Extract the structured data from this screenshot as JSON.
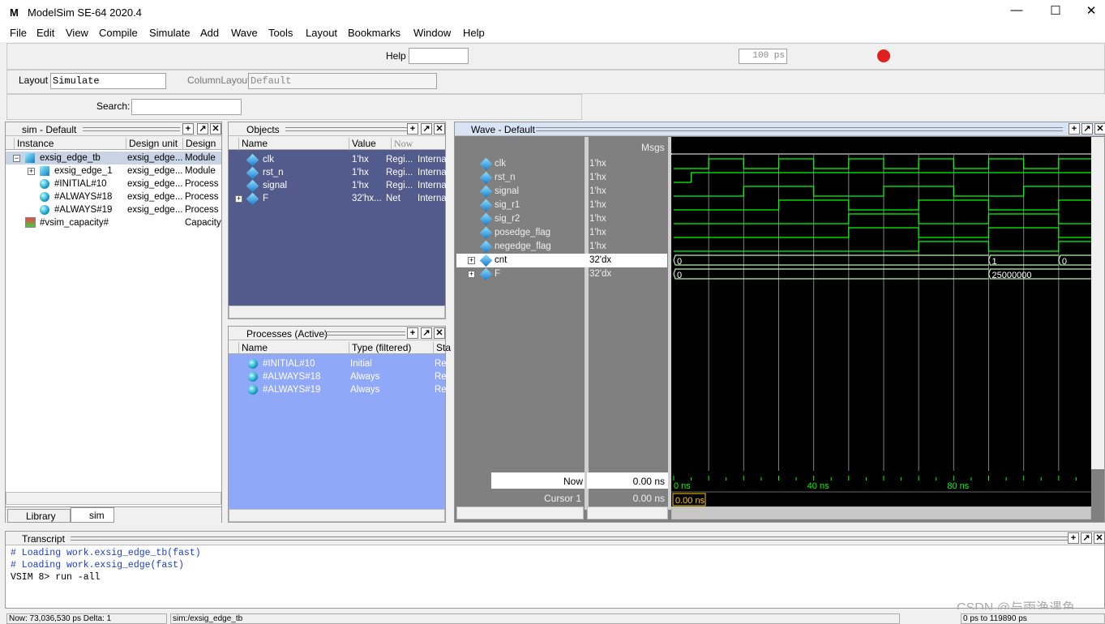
{
  "app": {
    "title": "ModelSim SE-64 2020.4",
    "logo": "M"
  },
  "menu": [
    "File",
    "Edit",
    "View",
    "Compile",
    "Simulate",
    "Add",
    "Wave",
    "Tools",
    "Layout",
    "Bookmarks",
    "Window",
    "Help"
  ],
  "toolbar": {
    "help_label": "Help",
    "help_value": "",
    "run_length": "100 ps",
    "layout_label": "Layout",
    "layout_value": "Simulate",
    "column_layout_label": "ColumnLayout",
    "column_layout_value": "Default",
    "search_label": "Search:",
    "search_value": ""
  },
  "sim_panel": {
    "title": "sim - Default",
    "columns": [
      "Instance",
      "Design unit",
      "Design ur"
    ],
    "rows": [
      {
        "name": "exsig_edge_tb",
        "unit": "exsig_edge...",
        "type": "Module"
      },
      {
        "name": "exsig_edge_1",
        "unit": "exsig_edge...",
        "type": "Module"
      },
      {
        "name": "#INITIAL#10",
        "unit": "exsig_edge...",
        "type": "Process"
      },
      {
        "name": "#ALWAYS#18",
        "unit": "exsig_edge...",
        "type": "Process"
      },
      {
        "name": "#ALWAYS#19",
        "unit": "exsig_edge...",
        "type": "Process"
      },
      {
        "name": "#vsim_capacity#",
        "unit": "",
        "type": "Capacity"
      }
    ],
    "tabs": [
      "Library",
      "sim"
    ]
  },
  "objects_panel": {
    "title": "Objects",
    "columns": [
      "Name",
      "Value",
      "Now"
    ],
    "rows": [
      {
        "name": "clk",
        "value": "1'hx",
        "kind": "Regi...",
        "mode": "Interna"
      },
      {
        "name": "rst_n",
        "value": "1'hx",
        "kind": "Regi...",
        "mode": "Interna"
      },
      {
        "name": "signal",
        "value": "1'hx",
        "kind": "Regi...",
        "mode": "Interna"
      },
      {
        "name": "F",
        "value": "32'hx...",
        "kind": "Net",
        "mode": "Interna"
      }
    ]
  },
  "processes_panel": {
    "title": "Processes (Active)",
    "columns": [
      "Name",
      "Type (filtered)",
      "Sta"
    ],
    "rows": [
      {
        "name": "#INITIAL#10",
        "type": "Initial",
        "state": "Re"
      },
      {
        "name": "#ALWAYS#18",
        "type": "Always",
        "state": "Re"
      },
      {
        "name": "#ALWAYS#19",
        "type": "Always",
        "state": "Re"
      }
    ]
  },
  "wave": {
    "title": "Wave - Default",
    "msgs_label": "Msgs",
    "now_label": "Now",
    "now_value": "0.00 ns",
    "cursor_label": "Cursor 1",
    "cursor_value": "0.00 ns",
    "cursor_marker": "0.00 ns",
    "time_range_ns": [
      0,
      120
    ],
    "time_labels": [
      "0 ns",
      "40 ns",
      "80 ns"
    ],
    "colors": {
      "wave": "#00ff00",
      "grid": "#808080",
      "bg": "#000000",
      "cursor": "#ffcc00"
    },
    "signals": [
      {
        "name": "clk",
        "value": "1'hx",
        "type": "bit",
        "init": 0,
        "edges": [
          10,
          20,
          30,
          40,
          50,
          60,
          70,
          80,
          90,
          100,
          110,
          120
        ]
      },
      {
        "name": "rst_n",
        "value": "1'hx",
        "type": "bit",
        "init": 0,
        "edges": [
          5
        ]
      },
      {
        "name": "signal",
        "value": "1'hx",
        "type": "bit",
        "init": 0,
        "edges": [
          20,
          40,
          60,
          80,
          100
        ]
      },
      {
        "name": "sig_r1",
        "value": "1'hx",
        "type": "bit",
        "init": 0,
        "edges": [
          30,
          50,
          70,
          90,
          110
        ]
      },
      {
        "name": "sig_r2",
        "value": "1'hx",
        "type": "bit",
        "init": 0,
        "edges": [
          50,
          70,
          90,
          110
        ]
      },
      {
        "name": "posedge_flag",
        "value": "1'hx",
        "type": "bit",
        "init": 0,
        "edges": [
          50,
          70,
          90,
          110
        ]
      },
      {
        "name": "negedge_flag",
        "value": "1'hx",
        "type": "bit",
        "init": 0,
        "edges": [
          70,
          90,
          110
        ]
      },
      {
        "name": "cnt",
        "value": "32'dx",
        "type": "bus",
        "segments": [
          {
            "t": 0,
            "v": "0"
          },
          {
            "t": 90,
            "v": "1"
          },
          {
            "t": 110,
            "v": "0"
          }
        ]
      },
      {
        "name": "F",
        "value": "32'dx",
        "type": "bus",
        "segments": [
          {
            "t": 0,
            "v": "0"
          },
          {
            "t": 90,
            "v": "25000000"
          }
        ]
      }
    ]
  },
  "transcript": {
    "title": "Transcript",
    "lines": [
      "# Loading work.exsig_edge_tb(fast)",
      "# Loading work.exsig_edge(fast)",
      "VSIM 8> run -all"
    ]
  },
  "status": {
    "now": "Now: 73,036,530 ps  Delta: 1",
    "context": "sim:/exsig_edge_tb",
    "range": "0 ps to 119890 ps"
  },
  "watermark": "CSDN @与雨渔遇鱼"
}
